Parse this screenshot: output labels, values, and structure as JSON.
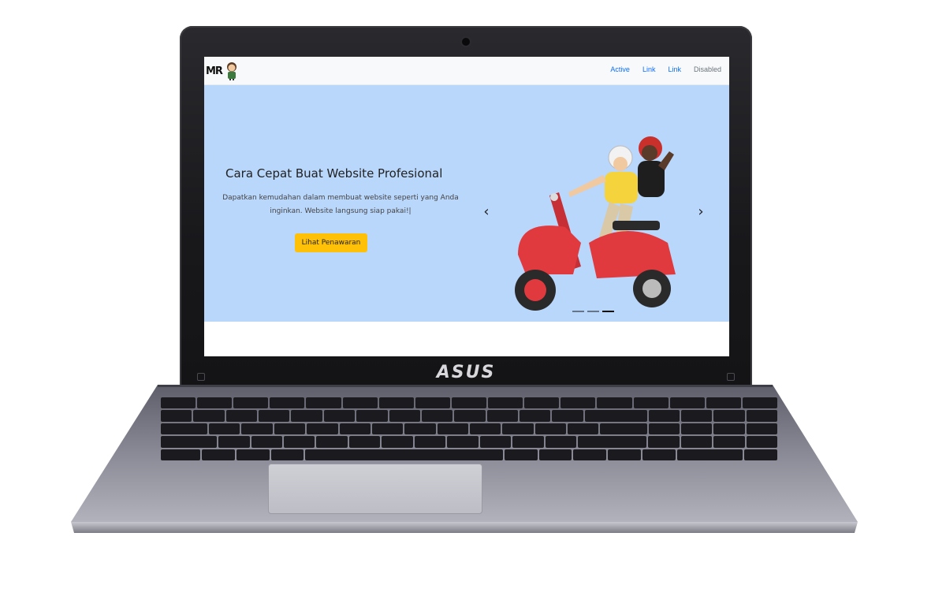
{
  "device": {
    "brand": "ASUS"
  },
  "website": {
    "navbar": {
      "logo_text": "MR",
      "links": [
        {
          "label": "Active",
          "state": "active"
        },
        {
          "label": "Link",
          "state": "normal"
        },
        {
          "label": "Link",
          "state": "normal"
        },
        {
          "label": "Disabled",
          "state": "disabled"
        }
      ]
    },
    "hero": {
      "title": "Cara Cepat Buat Website Profesional",
      "description": "Dapatkan kemudahan dalam membuat website seperti yang Anda inginkan. Website langsung siap pakai!|",
      "cta_label": "Lihat Penawaran",
      "prev_icon": "‹",
      "next_icon": "›",
      "slide_count": 3,
      "active_slide": 3
    }
  },
  "colors": {
    "hero_bg": "#b9d6fb",
    "cta_bg": "#ffc107",
    "link": "#0d6efd",
    "disabled_link": "#6c757d",
    "scooter": "#e0393e"
  }
}
